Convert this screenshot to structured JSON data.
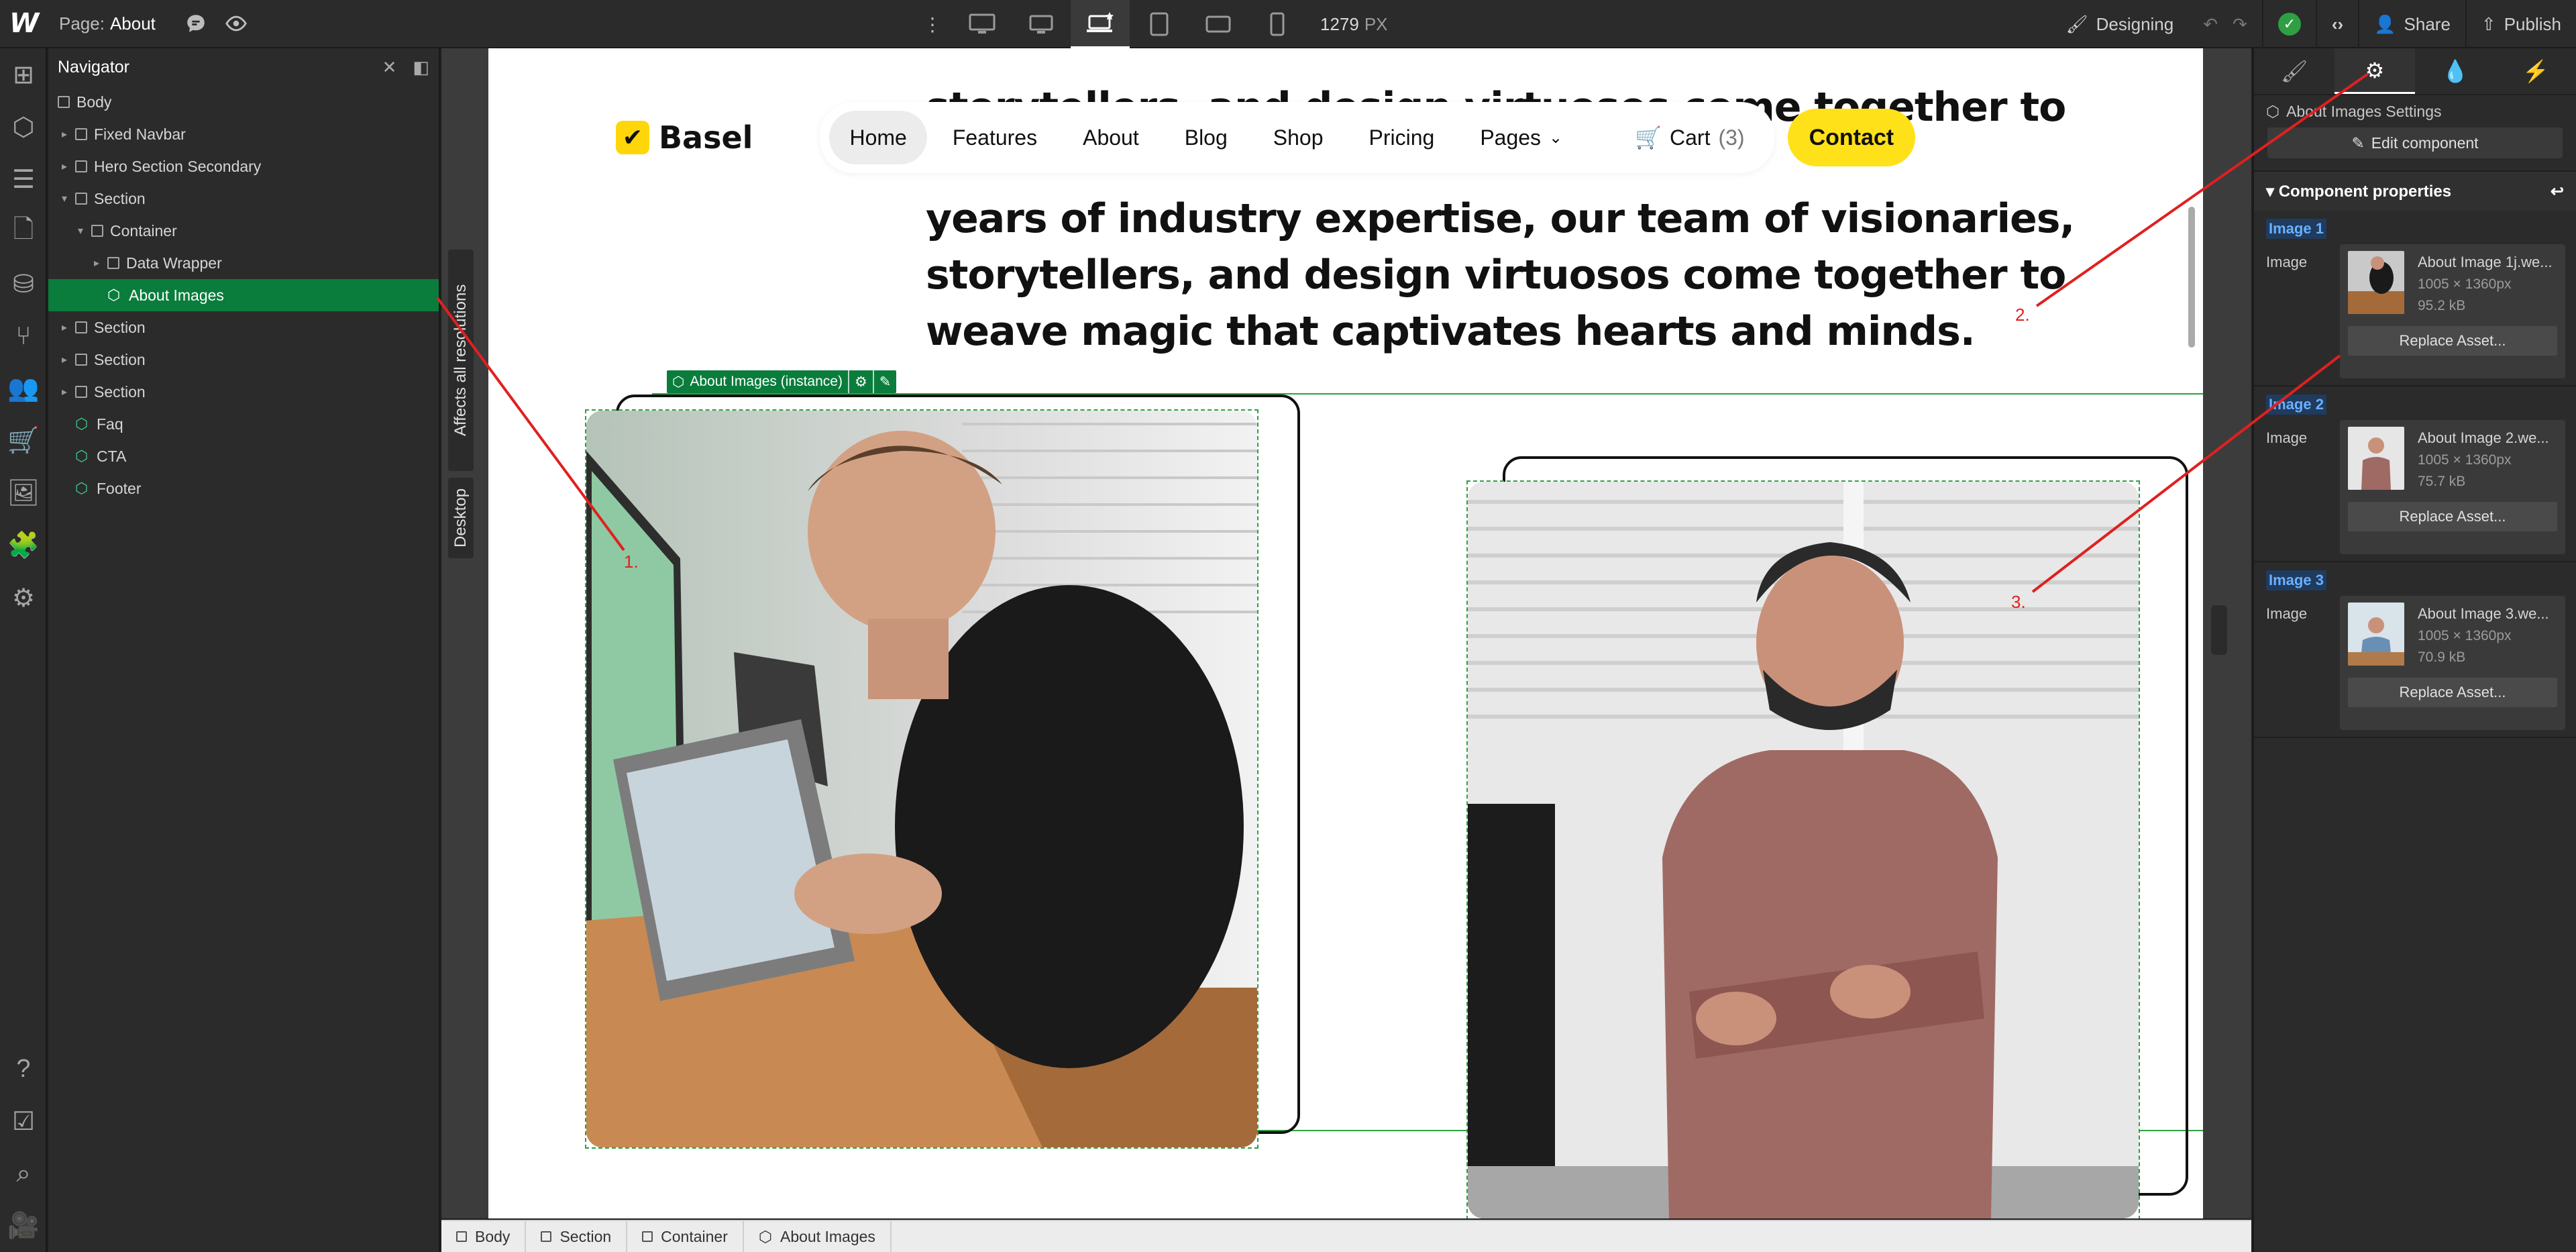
{
  "topbar": {
    "logo": "W",
    "page_prefix": "Page:",
    "page_name": "About",
    "viewport_width": "1279",
    "viewport_unit": "PX",
    "designing_label": "Designing",
    "share_label": "Share",
    "publish_label": "Publish"
  },
  "navigator": {
    "title": "Navigator",
    "items": [
      {
        "label": "Body"
      },
      {
        "label": "Fixed Navbar"
      },
      {
        "label": "Hero Section Secondary"
      },
      {
        "label": "Section"
      },
      {
        "label": "Container"
      },
      {
        "label": "Data Wrapper"
      },
      {
        "label": "About Images"
      },
      {
        "label": "Section"
      },
      {
        "label": "Section"
      },
      {
        "label": "Section"
      },
      {
        "label": "Faq"
      },
      {
        "label": "CTA"
      },
      {
        "label": "Footer"
      }
    ]
  },
  "canvas": {
    "side_tab_top": "Affects all resolutions",
    "side_tab_bottom": "Desktop",
    "hero_lines_top": [
      "storytellers, and design virtuosos come together to"
    ],
    "hero_lines_mid": [
      "years of industry expertise, our team of visionaries,",
      "storytellers, and design virtuosos come together to",
      "weave magic that captivates hearts and minds."
    ],
    "brand": "Basel",
    "menu": [
      "Home",
      "Features",
      "About",
      "Blog",
      "Shop",
      "Pricing",
      "Pages"
    ],
    "cart_label": "Cart",
    "cart_count": "(3)",
    "contact_label": "Contact",
    "instance_badge": "About Images (instance)"
  },
  "right_panel": {
    "settings_title": "About Images Settings",
    "edit_component": "Edit component",
    "component_properties": "Component properties",
    "images": [
      {
        "tag": "Image 1",
        "prop": "Image",
        "name": "About Image 1j.we...",
        "dims": "1005 × 1360px",
        "size": "95.2 kB",
        "replace": "Replace Asset..."
      },
      {
        "tag": "Image 2",
        "prop": "Image",
        "name": "About Image 2.we...",
        "dims": "1005 × 1360px",
        "size": "75.7 kB",
        "replace": "Replace Asset..."
      },
      {
        "tag": "Image 3",
        "prop": "Image",
        "name": "About Image 3.we...",
        "dims": "1005 × 1360px",
        "size": "70.9 kB",
        "replace": "Replace Asset..."
      }
    ]
  },
  "breadcrumb": [
    "Body",
    "Section",
    "Container",
    "About Images"
  ],
  "annotations": [
    "1.",
    "2.",
    "3."
  ],
  "colors": {
    "selection_green": "#0a7d3c",
    "brand_yellow": "#ffd60a",
    "annotation_red": "#e02020"
  }
}
